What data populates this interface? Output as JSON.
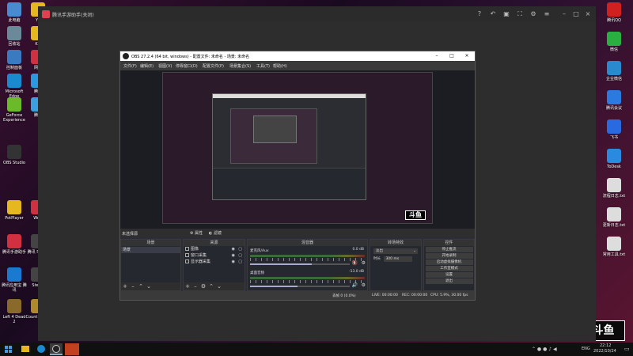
{
  "desktop": {
    "left_icons": [
      {
        "label": "此电脑",
        "color": "#4a8ad0"
      },
      {
        "label": "YY",
        "color": "#e6b820"
      },
      {
        "label": "回收站",
        "color": "#6a8a9a"
      },
      {
        "label": "KD",
        "color": "#e6b820"
      },
      {
        "label": "控制面板",
        "color": "#3a7ac0"
      },
      {
        "label": "网易",
        "color": "#d03040"
      },
      {
        "label": "Microsoft Edge",
        "color": "#1a8ad0"
      },
      {
        "label": "腾讯",
        "color": "#2a9ae0"
      },
      {
        "label": "GeForce Experience",
        "color": "#6aba2a"
      },
      {
        "label": "腾讯",
        "color": "#3aa0e0"
      },
      {
        "label": "OBS Studio",
        "color": "#333"
      },
      {
        "label": "PotPlayer",
        "color": "#e6b820"
      },
      {
        "label": "WeG",
        "color": "#d03040"
      },
      {
        "label": "腾讯手游助手",
        "color": "#d03040"
      },
      {
        "label": "腾讯 SteGa",
        "color": "#444"
      },
      {
        "label": "腾讯应用宝 腾讯",
        "color": "#1a7ad0"
      },
      {
        "label": "SteGa",
        "color": "#444"
      },
      {
        "label": "Left 4 Dead 2",
        "color": "#8a6a2a"
      },
      {
        "label": "Count Globa",
        "color": "#b08a2a"
      }
    ],
    "right_icons": [
      {
        "label": "腾讯QQ",
        "color": "#d02020"
      },
      {
        "label": "微信",
        "color": "#2ab040"
      },
      {
        "label": "企业微信",
        "color": "#2a8ad0"
      },
      {
        "label": "腾讯会议",
        "color": "#2a7ae0"
      },
      {
        "label": "飞书",
        "color": "#2a6ae0"
      },
      {
        "label": "ToDesk",
        "color": "#2a8ae0"
      },
      {
        "label": "流程日志.txt",
        "color": "#ddd"
      },
      {
        "label": "更新日志.txt",
        "color": "#ddd"
      },
      {
        "label": "常用工具.txt",
        "color": "#ddd"
      }
    ],
    "brand_watermark": "斗鱼"
  },
  "app_window": {
    "title": "腾讯手游助手(关闭)"
  },
  "obs": {
    "title": "OBS 27.2.4 (64 bit, windows) - 配置文件: 未命名 - 场景: 未命名",
    "menu": [
      "文件(F)",
      "编辑(E)",
      "视图(V)",
      "停靠窗口(D)",
      "配置文件(P)",
      "场景集合(S)",
      "工具(T)",
      "帮助(H)"
    ],
    "source_label": "未选择源",
    "props_btn": "属性",
    "filters_btn": "滤镜",
    "scenes": {
      "title": "场景",
      "items": [
        "场景"
      ]
    },
    "sources": {
      "title": "来源",
      "items": [
        "图像",
        "窗口采集",
        "显示器采集"
      ]
    },
    "mixer": {
      "title": "混音器",
      "tracks": [
        {
          "name": "麦克风/Aux",
          "db": "0.0 dB",
          "level": 0.62,
          "muted": true
        },
        {
          "name": "桌面音频",
          "db": "-13.0 dB",
          "level": 0.48,
          "muted": false
        }
      ]
    },
    "transitions": {
      "title": "转场特效",
      "type": "淡出",
      "duration_label": "时长",
      "duration": "300 ms"
    },
    "controls": {
      "title": "控件",
      "buttons": [
        "停止推流",
        "开始录制",
        "启动虚拟摄像机",
        "工作室模式",
        "设置",
        "退出"
      ]
    },
    "status": {
      "dropped": "丢帧 0 (0.0%)",
      "live": "LIVE: 00:00:00",
      "rec": "REC: 00:00:00",
      "cpu": "CPU: 5.9%, 30.00 fps"
    }
  },
  "taskbar": {
    "lang": "ENG",
    "time": "22:12",
    "date": "2022/10/24"
  }
}
